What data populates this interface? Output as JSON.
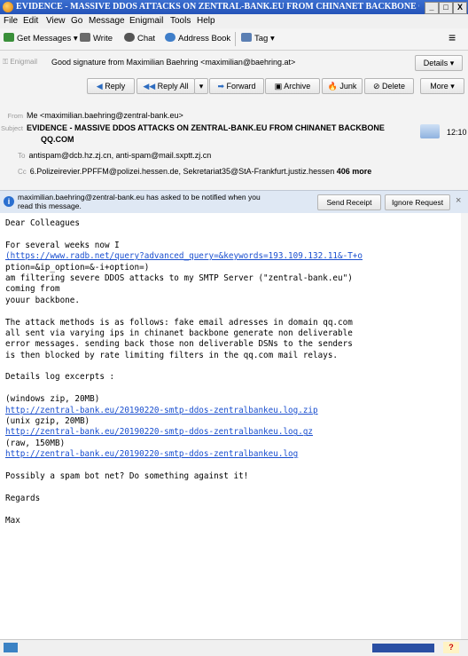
{
  "window": {
    "title": "EVIDENCE - MASSIVE DDOS ATTACKS ON ZENTRAL-BANK.EU FROM CHINANET BACKBONE QQ.COM...",
    "minimize": "_",
    "maximize": "□",
    "close": "X"
  },
  "menu": [
    "File",
    "Edit",
    "View",
    "Go",
    "Message",
    "Enigmail",
    "Tools",
    "Help"
  ],
  "toolbar": {
    "get_messages": "Get Messages",
    "write": "Write",
    "chat": "Chat",
    "address_book": "Address Book",
    "tag": "Tag",
    "menu_icon": "≡"
  },
  "enigmail": {
    "label": "Enigmail",
    "status": "Good signature from Maximilian Baehring <maximilian@baehring.at>",
    "details": "Details"
  },
  "actions": {
    "reply": "Reply",
    "reply_all": "Reply All",
    "forward": "Forward",
    "archive": "Archive",
    "junk": "Junk",
    "delete": "Delete",
    "more": "More"
  },
  "headers": {
    "from_label": "From",
    "from": "Me <maximilian.baehring@zentral-bank.eu>",
    "subject_label": "Subject",
    "subject_line1": "EVIDENCE - MASSIVE DDOS ATTACKS ON ZENTRAL-BANK.EU FROM CHINANET BACKBONE",
    "subject_line2": "QQ.COM",
    "time": "12:10",
    "to_label": "To",
    "to": "antispam@dcb.hz.zj.cn, anti-spam@mail.sxptt.zj.cn",
    "cc_label": "Cc",
    "cc": "6.Polizeirevier.PPFFM@polizei.hessen.de, Sekretariat35@StA-Frankfurt.justiz.hessen",
    "cc_more": "406 more"
  },
  "notification": {
    "text_line1": "maximilian.baehring@zentral-bank.eu has asked to be notified when you",
    "text_line2": "read this message.",
    "send_receipt": "Send Receipt",
    "ignore_request": "Ignore Request",
    "close": "×"
  },
  "body_lines": [
    {
      "text": "Dear Colleagues",
      "link": false
    },
    {
      "text": "",
      "link": false
    },
    {
      "text": "For several weeks now I",
      "link": false
    },
    {
      "text": "(https://www.radb.net/query?advanced_query=&keywords=193.109.132.11&-T+o",
      "link": true
    },
    {
      "text": "ption=&ip_option=&-i+option=)",
      "link": false
    },
    {
      "text": "am filtering severe DDOS attacks to my SMTP Server (\"zentral-bank.eu\")",
      "link": false
    },
    {
      "text": "coming from",
      "link": false
    },
    {
      "text": "youur backbone.",
      "link": false
    },
    {
      "text": "",
      "link": false
    },
    {
      "text": "The attack methods is as follows: fake email adresses in domain qq.com",
      "link": false
    },
    {
      "text": "all sent via varying ips in chinanet backbone generate non deliverable",
      "link": false
    },
    {
      "text": "error messages. sending back those non deliverable DSNs to the senders",
      "link": false
    },
    {
      "text": "is then blocked by rate limiting filters in the qq.com mail relays.",
      "link": false
    },
    {
      "text": "",
      "link": false
    },
    {
      "text": "Details log excerpts :",
      "link": false
    },
    {
      "text": "",
      "link": false
    },
    {
      "text": "(windows zip, 20MB)",
      "link": false
    },
    {
      "text": "http://zentral-bank.eu/20190220-smtp-ddos-zentralbankeu.log.zip",
      "link": true
    },
    {
      "text": "(unix gzip, 20MB)",
      "link": false
    },
    {
      "text": "http://zentral-bank.eu/20190220-smtp-ddos-zentralbankeu.log.gz",
      "link": true
    },
    {
      "text": "(raw, 150MB)",
      "link": false
    },
    {
      "text": "http://zentral-bank.eu/20190220-smtp-ddos-zentralbankeu.log",
      "link": true
    },
    {
      "text": "",
      "link": false
    },
    {
      "text": "Possibly a spam bot net? Do something against it!",
      "link": false
    },
    {
      "text": "",
      "link": false
    },
    {
      "text": "Regards",
      "link": false
    },
    {
      "text": "",
      "link": false
    },
    {
      "text": "Max",
      "link": false
    }
  ]
}
